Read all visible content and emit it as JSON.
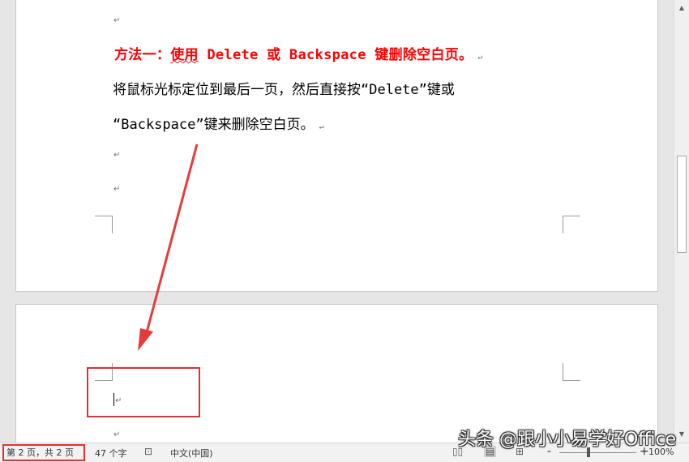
{
  "document": {
    "page1": {
      "heading": "方法一：使用 Delete 或 Backspace 键删除空白页。",
      "heading_squiggle": "使用",
      "body_line1": "将鼠标光标定位到最后一页，然后直接按“Delete”键或",
      "body_line2": "“Backspace”键来删除空白页。"
    },
    "paragraph_mark": "↵"
  },
  "statusbar": {
    "page_info": "第 2 页，共 2 页",
    "word_count": "47 个字",
    "proofing_icon": "proofing-icon",
    "language": "中文(中国)",
    "view_icons": [
      "read-mode-icon",
      "print-layout-icon",
      "web-layout-icon"
    ],
    "zoom_minus": "-",
    "zoom_plus": "+",
    "zoom_level": "100%"
  },
  "watermark": "头条 @跟小小易学好Office",
  "annotation_colors": {
    "red": "#e03030"
  }
}
